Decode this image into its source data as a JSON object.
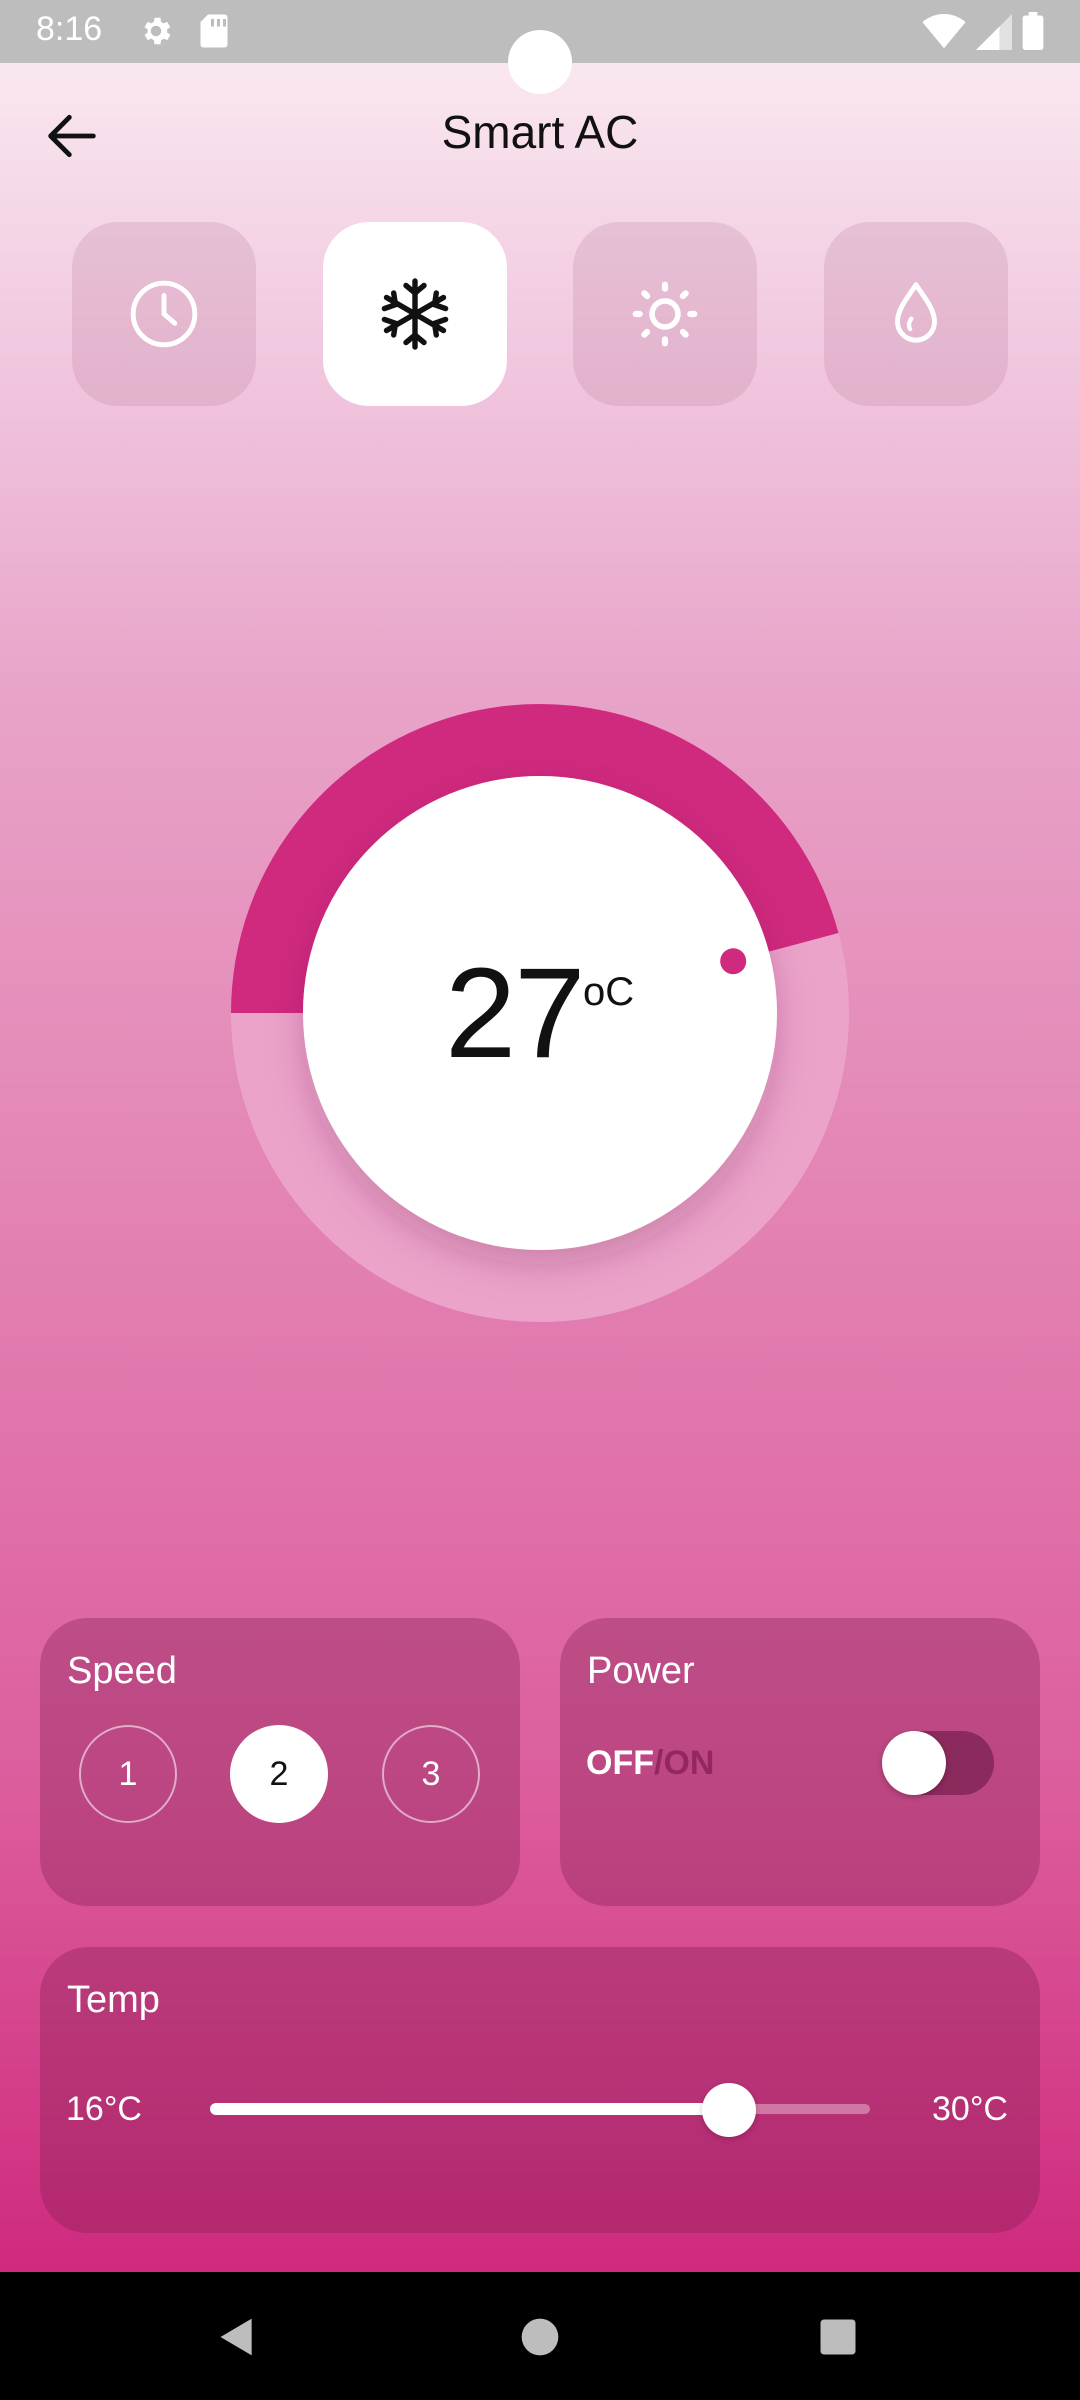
{
  "status_bar": {
    "time": "8:16",
    "icons": [
      "gear-icon",
      "sd-card-icon",
      "wifi-icon",
      "signal-icon",
      "battery-icon"
    ]
  },
  "header": {
    "title": "Smart AC",
    "back_icon": "arrow-left-icon"
  },
  "modes": [
    {
      "name": "timer",
      "icon": "clock-icon",
      "active": false
    },
    {
      "name": "cool",
      "icon": "snowflake-icon",
      "active": true
    },
    {
      "name": "heat",
      "icon": "sun-icon",
      "active": false
    },
    {
      "name": "dry",
      "icon": "water-drop-icon",
      "active": false
    }
  ],
  "dial": {
    "temperature": "27",
    "unit": "oC",
    "min": 16,
    "max": 30,
    "value": 27
  },
  "speed": {
    "title": "Speed",
    "options": [
      "1",
      "2",
      "3"
    ],
    "selected": "2"
  },
  "power": {
    "title": "Power",
    "off_label": "OFF",
    "separator": "/",
    "on_label": "ON",
    "is_on": false
  },
  "temp": {
    "title": "Temp",
    "min_label": "16°C",
    "max_label": "30°C",
    "min": 16,
    "max": 30,
    "value": 27
  },
  "colors": {
    "accent": "#cf2a7e",
    "accent_track": "#eba3ca",
    "card": "#8c2c62"
  },
  "nav": {
    "icons": [
      "back-triangle-icon",
      "home-circle-icon",
      "recents-square-icon"
    ]
  }
}
